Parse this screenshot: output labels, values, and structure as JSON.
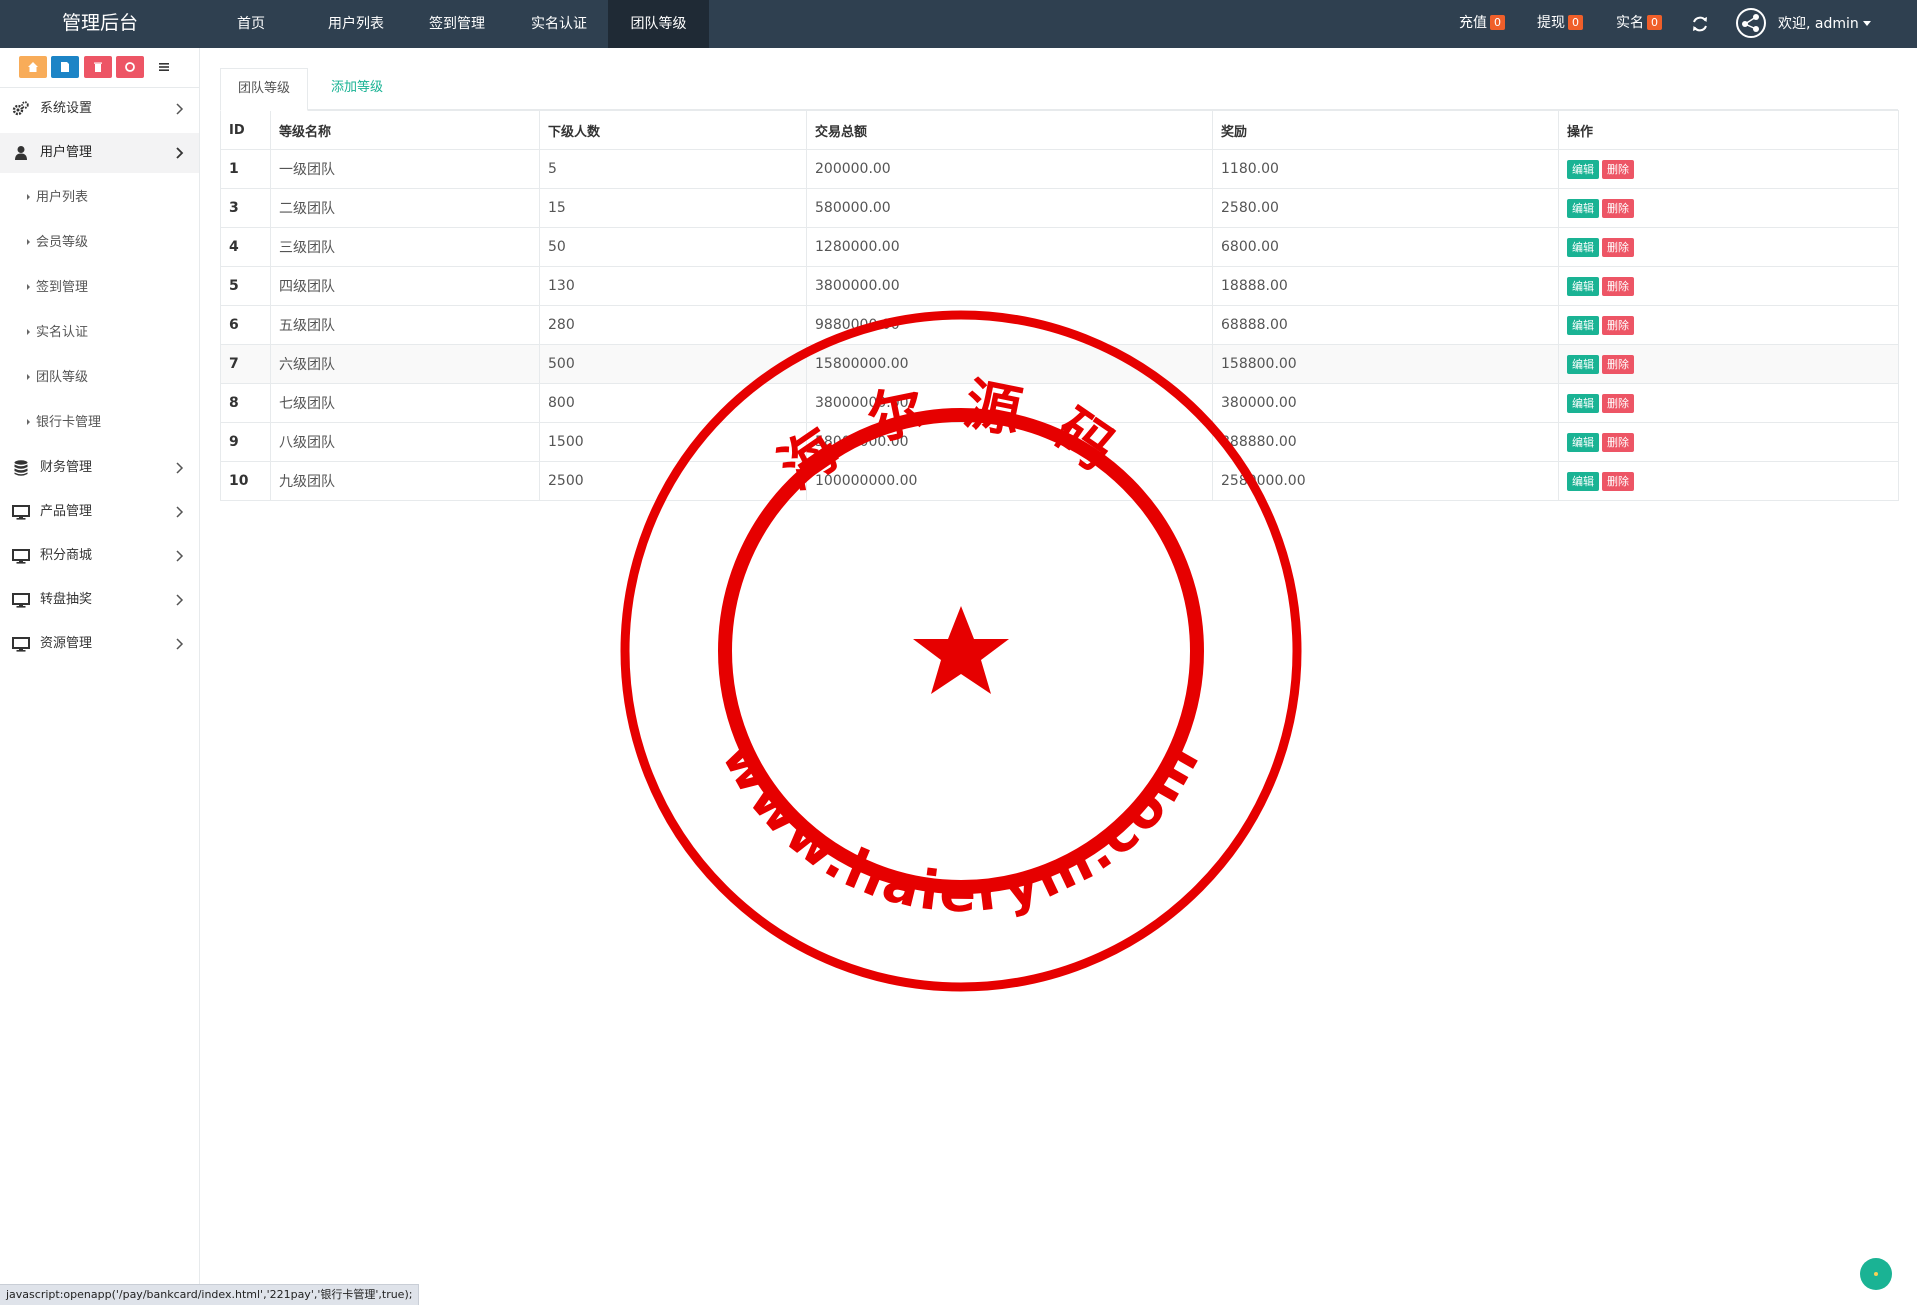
{
  "header": {
    "brand": "管理后台",
    "nav": [
      {
        "label": "首页"
      },
      {
        "label": "用户列表"
      },
      {
        "label": "签到管理"
      },
      {
        "label": "实名认证"
      },
      {
        "label": "团队等级"
      }
    ],
    "counters": [
      {
        "label": "充值",
        "count": "0"
      },
      {
        "label": "提现",
        "count": "0"
      },
      {
        "label": "实名",
        "count": "0"
      }
    ],
    "user_greeting": "欢迎, admin"
  },
  "colors": {
    "topbar": "#2f4050",
    "active_nav": "#1f2a35",
    "primary": "#1ab394",
    "danger": "#ed5565",
    "badge": "#f05f2a",
    "stamp": "#e60000"
  },
  "sidebar": {
    "quick_buttons": [
      {
        "icon": "home-icon",
        "color": "#f8ac59"
      },
      {
        "icon": "file-icon",
        "color": "#23c6c8"
      },
      {
        "icon": "trash-icon",
        "color": "#ed5565"
      },
      {
        "icon": "recycle-icon",
        "color": "#ed5565"
      },
      {
        "icon": "list-icon",
        "color": "#ffffff"
      }
    ],
    "menu": [
      {
        "label": "系统设置",
        "icon": "gears-icon"
      },
      {
        "label": "用户管理",
        "icon": "user-icon"
      },
      {
        "label": "财务管理",
        "icon": "database-icon"
      },
      {
        "label": "产品管理",
        "icon": "desktop-icon"
      },
      {
        "label": "积分商城",
        "icon": "desktop-icon"
      },
      {
        "label": "转盘抽奖",
        "icon": "desktop-icon"
      },
      {
        "label": "资源管理",
        "icon": "desktop-icon"
      }
    ],
    "submenu": [
      {
        "label": "用户列表"
      },
      {
        "label": "会员等级"
      },
      {
        "label": "签到管理"
      },
      {
        "label": "实名认证"
      },
      {
        "label": "团队等级"
      },
      {
        "label": "银行卡管理"
      }
    ]
  },
  "tabs": [
    {
      "label": "团队等级"
    },
    {
      "label": "添加等级"
    }
  ],
  "table": {
    "columns": [
      "ID",
      "等级名称",
      "下级人数",
      "交易总额",
      "奖励",
      "操作"
    ],
    "edit_label": "编辑",
    "delete_label": "删除",
    "rows": [
      {
        "id": "1",
        "name": "一级团队",
        "count": "5",
        "total": "200000.00",
        "reward": "1180.00"
      },
      {
        "id": "3",
        "name": "二级团队",
        "count": "15",
        "total": "580000.00",
        "reward": "2580.00"
      },
      {
        "id": "4",
        "name": "三级团队",
        "count": "50",
        "total": "1280000.00",
        "reward": "6800.00"
      },
      {
        "id": "5",
        "name": "四级团队",
        "count": "130",
        "total": "3800000.00",
        "reward": "18888.00"
      },
      {
        "id": "6",
        "name": "五级团队",
        "count": "280",
        "total": "9880000.00",
        "reward": "68888.00"
      },
      {
        "id": "7",
        "name": "六级团队",
        "count": "500",
        "total": "15800000.00",
        "reward": "158800.00"
      },
      {
        "id": "8",
        "name": "七级团队",
        "count": "800",
        "total": "38000000.00",
        "reward": "380000.00"
      },
      {
        "id": "9",
        "name": "八级团队",
        "count": "1500",
        "total": "58000000.00",
        "reward": "888880.00"
      },
      {
        "id": "10",
        "name": "九级团队",
        "count": "2500",
        "total": "100000000.00",
        "reward": "2580000.00"
      }
    ]
  },
  "watermark": {
    "top_text": "海尔源码",
    "bottom_text": "www.haierym.com"
  },
  "status_url": "javascript:openapp('/pay/bankcard/index.html','221pay','银行卡管理',true);"
}
